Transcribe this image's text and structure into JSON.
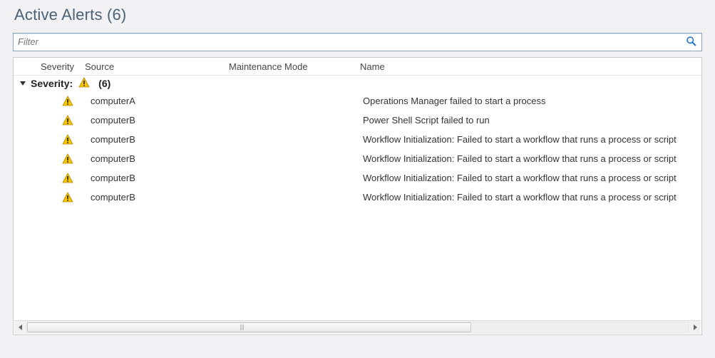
{
  "title": "Active Alerts (6)",
  "filter": {
    "placeholder": "Filter",
    "value": ""
  },
  "columns": {
    "severity": "Severity",
    "source": "Source",
    "maintenance_mode": "Maintenance Mode",
    "name": "Name"
  },
  "group": {
    "label": "Severity:",
    "icon": "warning-icon",
    "count_text": "(6)"
  },
  "rows": [
    {
      "severity_icon": "warning-icon",
      "source": "computerA",
      "maintenance_mode": "",
      "name": "Operations Manager failed to start a process"
    },
    {
      "severity_icon": "warning-icon",
      "source": "computerB",
      "maintenance_mode": "",
      "name": "Power Shell Script failed to run"
    },
    {
      "severity_icon": "warning-icon",
      "source": "computerB",
      "maintenance_mode": "",
      "name": "Workflow Initialization: Failed to start a workflow that runs a process or script"
    },
    {
      "severity_icon": "warning-icon",
      "source": "computerB",
      "maintenance_mode": "",
      "name": "Workflow Initialization: Failed to start a workflow that runs a process or script"
    },
    {
      "severity_icon": "warning-icon",
      "source": "computerB",
      "maintenance_mode": "",
      "name": "Workflow Initialization: Failed to start a workflow that runs a process or script"
    },
    {
      "severity_icon": "warning-icon",
      "source": "computerB",
      "maintenance_mode": "",
      "name": "Workflow Initialization: Failed to start a workflow that runs a process or script"
    }
  ]
}
